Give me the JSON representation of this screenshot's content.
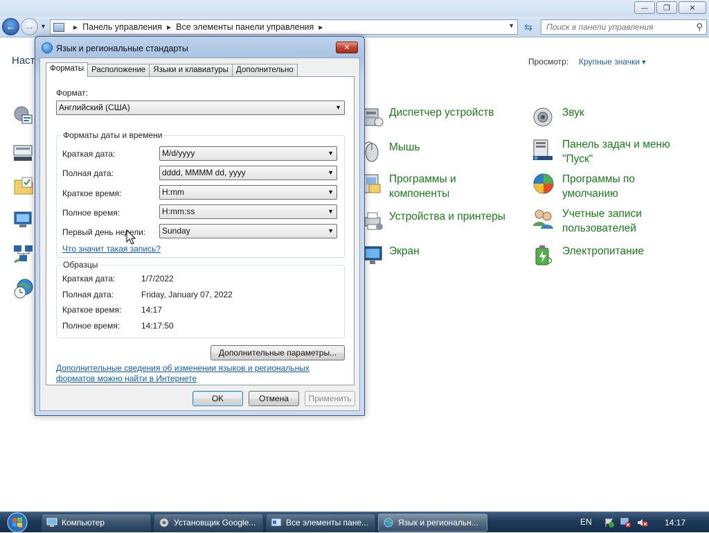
{
  "explorer": {
    "window_controls": {
      "minimize": "—",
      "maximize": "❐",
      "close": "✕"
    },
    "breadcrumb": [
      "Панель управления",
      "Все элементы панели управления"
    ],
    "search_placeholder": "Поиск в панели управления",
    "heading": "Наст",
    "view_label": "Просмотр:",
    "view_value": "Крупные значки",
    "items": [
      {
        "label": "Диспетчер устройств",
        "icon": "device-manager-icon"
      },
      {
        "label": "Мышь",
        "icon": "mouse-icon"
      },
      {
        "label": "Программы и компоненты",
        "icon": "programs-features-icon"
      },
      {
        "label": "Устройства и принтеры",
        "icon": "devices-printers-icon"
      },
      {
        "label": "Экран",
        "icon": "display-icon"
      },
      {
        "label": "Звук",
        "icon": "sound-icon"
      },
      {
        "label": "Панель задач и меню \"Пуск\"",
        "icon": "taskbar-start-icon"
      },
      {
        "label": "Программы по умолчанию",
        "icon": "default-programs-icon"
      },
      {
        "label": "Учетные записи пользователей",
        "icon": "user-accounts-icon"
      },
      {
        "label": "Электропитание",
        "icon": "power-options-icon"
      }
    ]
  },
  "dialog": {
    "title": "Язык и региональные стандарты",
    "close_glyph": "✕",
    "tabs": [
      "Форматы",
      "Расположение",
      "Языки и клавиатуры",
      "Дополнительно"
    ],
    "format_label": "Формат:",
    "format_value": "Английский (США)",
    "datetime_group": {
      "title": "Форматы даты и времени",
      "rows": [
        {
          "label": "Краткая дата:",
          "value": "M/d/yyyy"
        },
        {
          "label": "Полная дата:",
          "value": "dddd, MMMM dd, yyyy"
        },
        {
          "label": "Краткое время:",
          "value": "H:mm"
        },
        {
          "label": "Полное время:",
          "value": "H:mm:ss"
        },
        {
          "label": "Первый день недели:",
          "value": "Sunday"
        }
      ],
      "help_link": "Что значит такая запись?"
    },
    "samples_group": {
      "title": "Образцы",
      "rows": [
        {
          "label": "Краткая дата:",
          "value": "1/7/2022"
        },
        {
          "label": "Полная дата:",
          "value": "Friday, January 07, 2022"
        },
        {
          "label": "Краткое время:",
          "value": "14:17"
        },
        {
          "label": "Полное время:",
          "value": "14:17:50"
        }
      ]
    },
    "advanced_button": "Дополнительные параметры...",
    "info_link_line1": "Дополнительные сведения об изменении языков и региональных",
    "info_link_line2": "форматов можно найти в Интернете",
    "ok": "OK",
    "cancel": "Отмена",
    "apply": "Применить"
  },
  "taskbar": {
    "tasks": [
      {
        "label": "Компьютер",
        "icon": "computer-icon"
      },
      {
        "label": "Установщик Google...",
        "icon": "installer-icon"
      },
      {
        "label": "Все элементы пане...",
        "icon": "control-panel-icon"
      },
      {
        "label": "Язык и региональн...",
        "icon": "globe-icon"
      }
    ],
    "language": "EN",
    "clock": "14:17"
  }
}
